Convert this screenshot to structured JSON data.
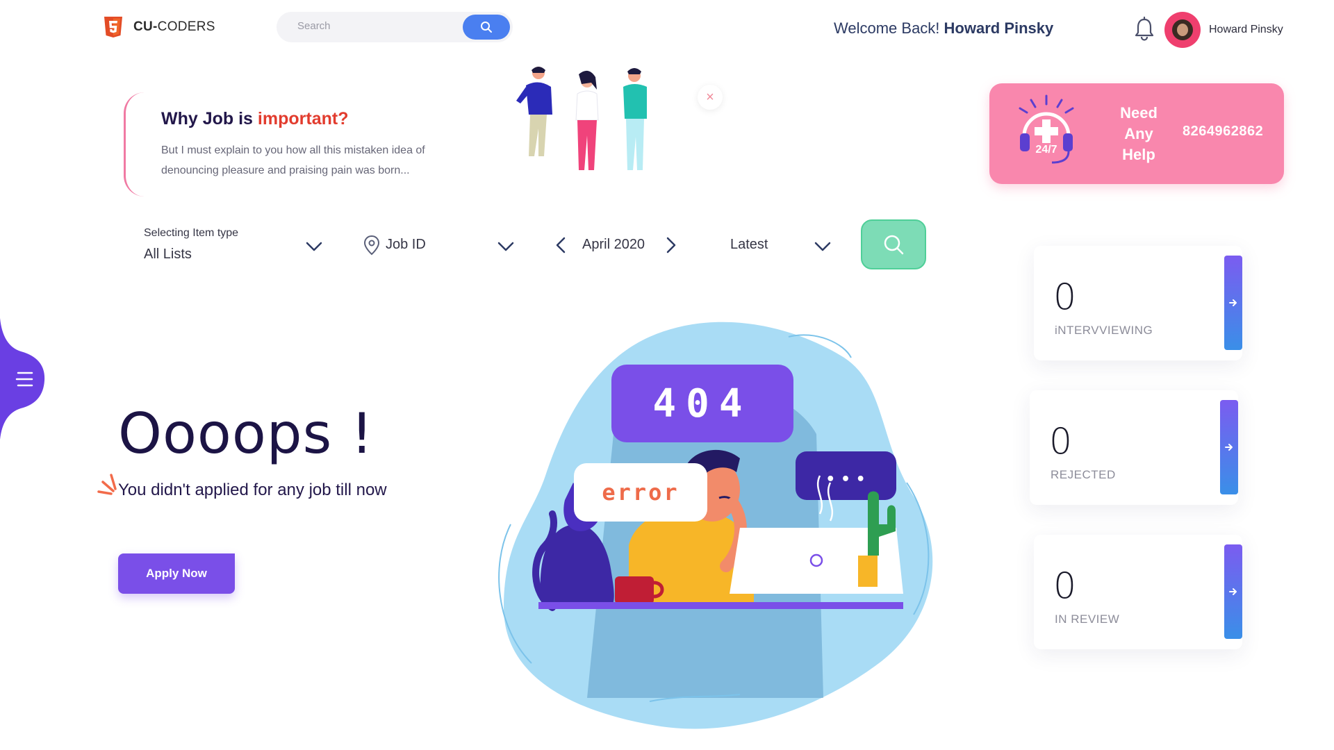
{
  "header": {
    "logo_bold": "CU-",
    "logo_rest": "CODERS",
    "search_placeholder": "Search",
    "welcome_prefix": "Welcome Back!",
    "welcome_name": "Howard Pinsky",
    "user_name": "Howard Pinsky"
  },
  "banner": {
    "title_prefix": "Why Job is",
    "title_highlight": "important?",
    "text": "But I must explain to you how all this mistaken idea of denouncing pleasure and praising pain was born...",
    "close_label": "×"
  },
  "help": {
    "line1": "Need",
    "line2": "Any",
    "line3": "Help",
    "badge": "24/7",
    "phone": "8264962862"
  },
  "filters": {
    "item_type_label": "Selecting Item type",
    "item_type_value": "All Lists",
    "job_id": "Job ID",
    "month": "April 2020",
    "sort": "Latest"
  },
  "empty_state": {
    "heading": "Oooops !",
    "message": "You didn't applied for any job till now",
    "apply_button": "Apply Now",
    "illustration_code": "404",
    "illustration_error": "error",
    "illustration_dots": "• • •"
  },
  "stats": [
    {
      "count": "0",
      "label": "iNTERVVIEWING"
    },
    {
      "count": "0",
      "label": "REJECTED"
    },
    {
      "count": "0",
      "label": "IN REVIEW"
    }
  ],
  "colors": {
    "primary_purple": "#7a4fe8",
    "search_blue": "#4a7ff0",
    "help_pink": "#f987ad",
    "filter_green": "#7ddcb6",
    "highlight_red": "#e23c2e"
  }
}
